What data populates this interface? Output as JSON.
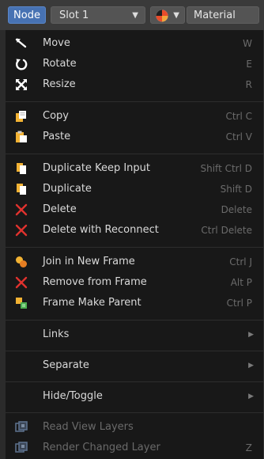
{
  "topbar": {
    "node_label": "Node",
    "slot_label": "Slot 1",
    "material_label": "Material"
  },
  "menu": {
    "move": {
      "label": "Move",
      "shortcut": "W"
    },
    "rotate": {
      "label": "Rotate",
      "shortcut": "E"
    },
    "resize": {
      "label": "Resize",
      "shortcut": "R"
    },
    "copy": {
      "label": "Copy",
      "shortcut": "Ctrl C"
    },
    "paste": {
      "label": "Paste",
      "shortcut": "Ctrl V"
    },
    "duplicate_keep_input": {
      "label": "Duplicate Keep Input",
      "shortcut": "Shift Ctrl D"
    },
    "duplicate": {
      "label": "Duplicate",
      "shortcut": "Shift D"
    },
    "delete": {
      "label": "Delete",
      "shortcut": "Delete"
    },
    "delete_with_reconnect": {
      "label": "Delete with Reconnect",
      "shortcut": "Ctrl Delete"
    },
    "join_in_new_frame": {
      "label": "Join in New Frame",
      "shortcut": "Ctrl J"
    },
    "remove_from_frame": {
      "label": "Remove from Frame",
      "shortcut": "Alt P"
    },
    "frame_make_parent": {
      "label": "Frame Make Parent",
      "shortcut": "Ctrl P"
    },
    "links": {
      "label": "Links"
    },
    "separate": {
      "label": "Separate"
    },
    "hide_toggle": {
      "label": "Hide/Toggle"
    },
    "read_view_layers": {
      "label": "Read View Layers",
      "shortcut": ""
    },
    "render_changed_layer": {
      "label": "Render Changed Layer",
      "shortcut": "Z"
    }
  },
  "colors": {
    "accent": "#4772b3",
    "delete_red": "#e0322e",
    "menu_bg": "#181818"
  }
}
